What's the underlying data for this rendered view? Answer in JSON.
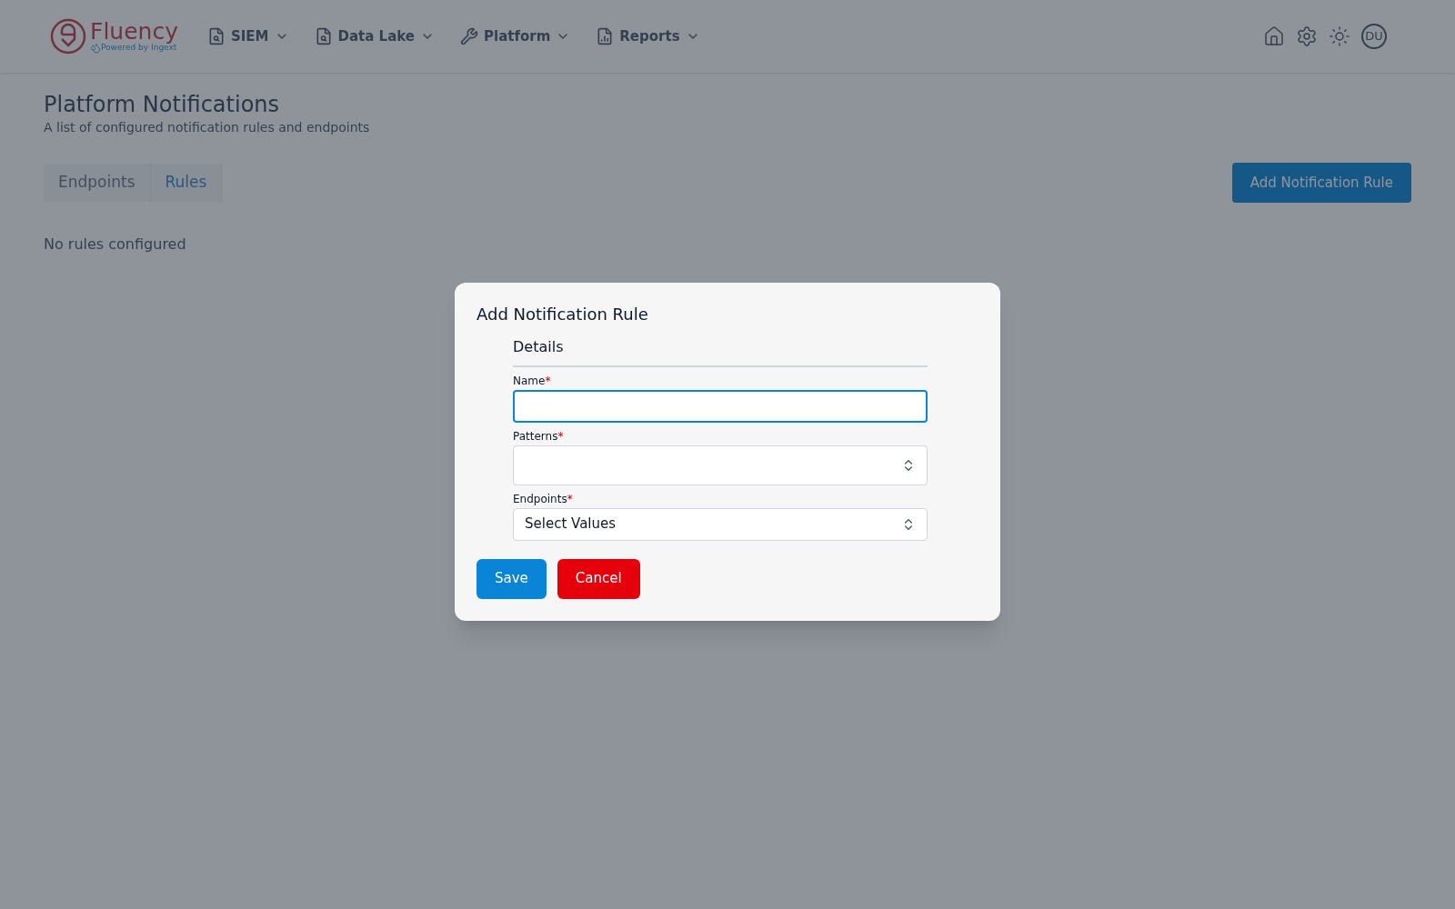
{
  "header": {
    "logo": {
      "name": "Fluency",
      "tagline": "Powered by Ingext"
    },
    "nav": [
      {
        "label": "SIEM"
      },
      {
        "label": "Data Lake"
      },
      {
        "label": "Platform"
      },
      {
        "label": "Reports"
      }
    ],
    "avatar": "DU"
  },
  "page": {
    "title": "Platform Notifications",
    "subtitle": "A list of configured notification rules and endpoints",
    "tabs": [
      {
        "label": "Endpoints",
        "selected": false
      },
      {
        "label": "Rules",
        "selected": true
      }
    ],
    "add_button": "Add Notification Rule",
    "empty_text": "No rules configured"
  },
  "dialog": {
    "title": "Add Notification Rule",
    "section": "Details",
    "fields": [
      {
        "kind": "text",
        "label": "Name",
        "required_mark": "*",
        "focused": true
      },
      {
        "kind": "select",
        "label": "Patterns",
        "required_mark": "*",
        "focused": false
      },
      {
        "kind": "select",
        "label": "Endpoints",
        "required_mark": "*",
        "placeholder": "Select Values",
        "focused": false
      }
    ],
    "buttons": [
      {
        "label": "Save",
        "kind": "primary"
      },
      {
        "label": "Cancel",
        "kind": "danger"
      }
    ]
  }
}
